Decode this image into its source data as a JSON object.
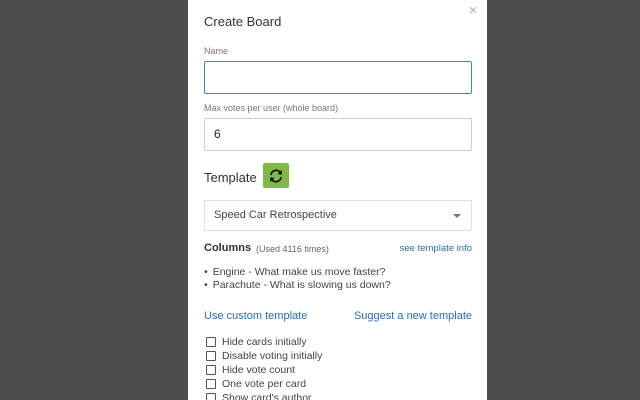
{
  "modal": {
    "title": "Create Board",
    "close_icon": "close-icon"
  },
  "name_field": {
    "label": "Name",
    "value": ""
  },
  "max_votes_field": {
    "label": "Max votes per user  (whole board)",
    "value": "6"
  },
  "template": {
    "label": "Template",
    "refresh_icon": "refresh-icon",
    "refresh_color": "#7dbb46",
    "selected": "Speed Car Retrospective"
  },
  "columns": {
    "title": "Columns",
    "used_text": "(Used 4116 times)",
    "see_template_link": "see template info",
    "items": [
      "Engine - What make us move faster?",
      "Parachute - What is slowing us down?"
    ]
  },
  "links": {
    "custom_template": "Use custom template",
    "suggest_template": "Suggest a new template"
  },
  "options": [
    {
      "label": "Hide cards initially",
      "checked": false
    },
    {
      "label": "Disable voting initially",
      "checked": false
    },
    {
      "label": "Hide vote count",
      "checked": false
    },
    {
      "label": "One vote per card",
      "checked": false
    },
    {
      "label": "Show card's author",
      "checked": false
    }
  ],
  "colors": {
    "overlay": "#4d4d4d",
    "link": "#2a6db5",
    "focus_border": "#3f88c5"
  }
}
